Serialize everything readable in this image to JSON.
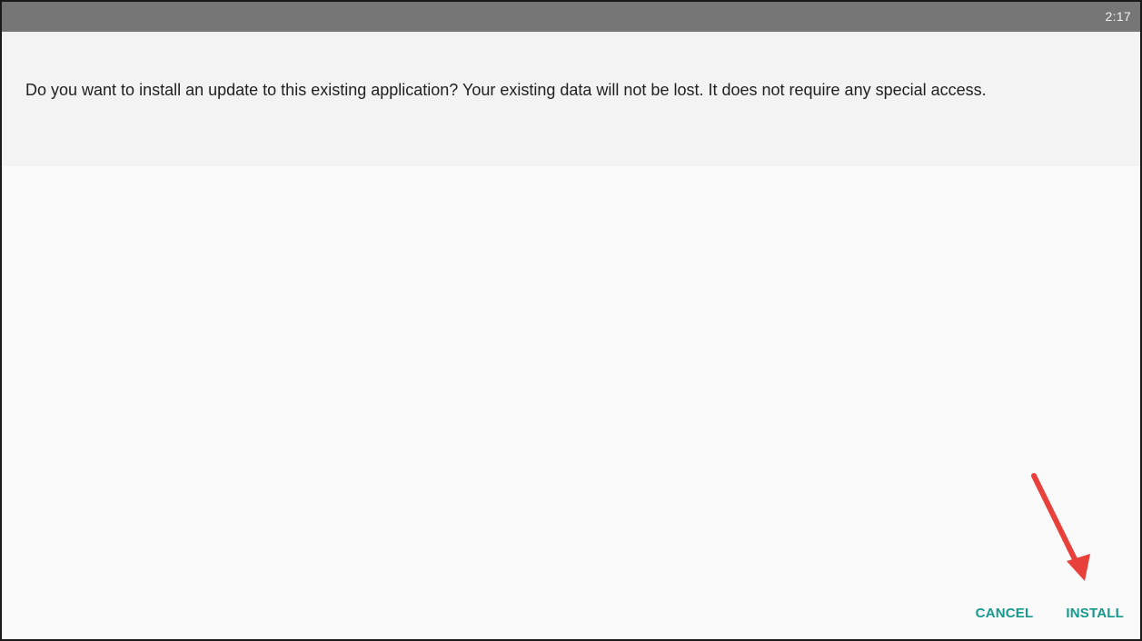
{
  "status_bar": {
    "time": "2:17"
  },
  "dialog": {
    "message": "Do you want to install an update to this existing application? Your existing data will not be lost. It does not require any special access."
  },
  "actions": {
    "cancel_label": "CANCEL",
    "install_label": "INSTALL"
  },
  "annotation": {
    "arrow_color": "#e8413c",
    "points_to": "install-button"
  },
  "colors": {
    "status_bar": "#767676",
    "accent": "#14998c",
    "message_panel": "#f3f3f3",
    "background": "#fafafa"
  }
}
